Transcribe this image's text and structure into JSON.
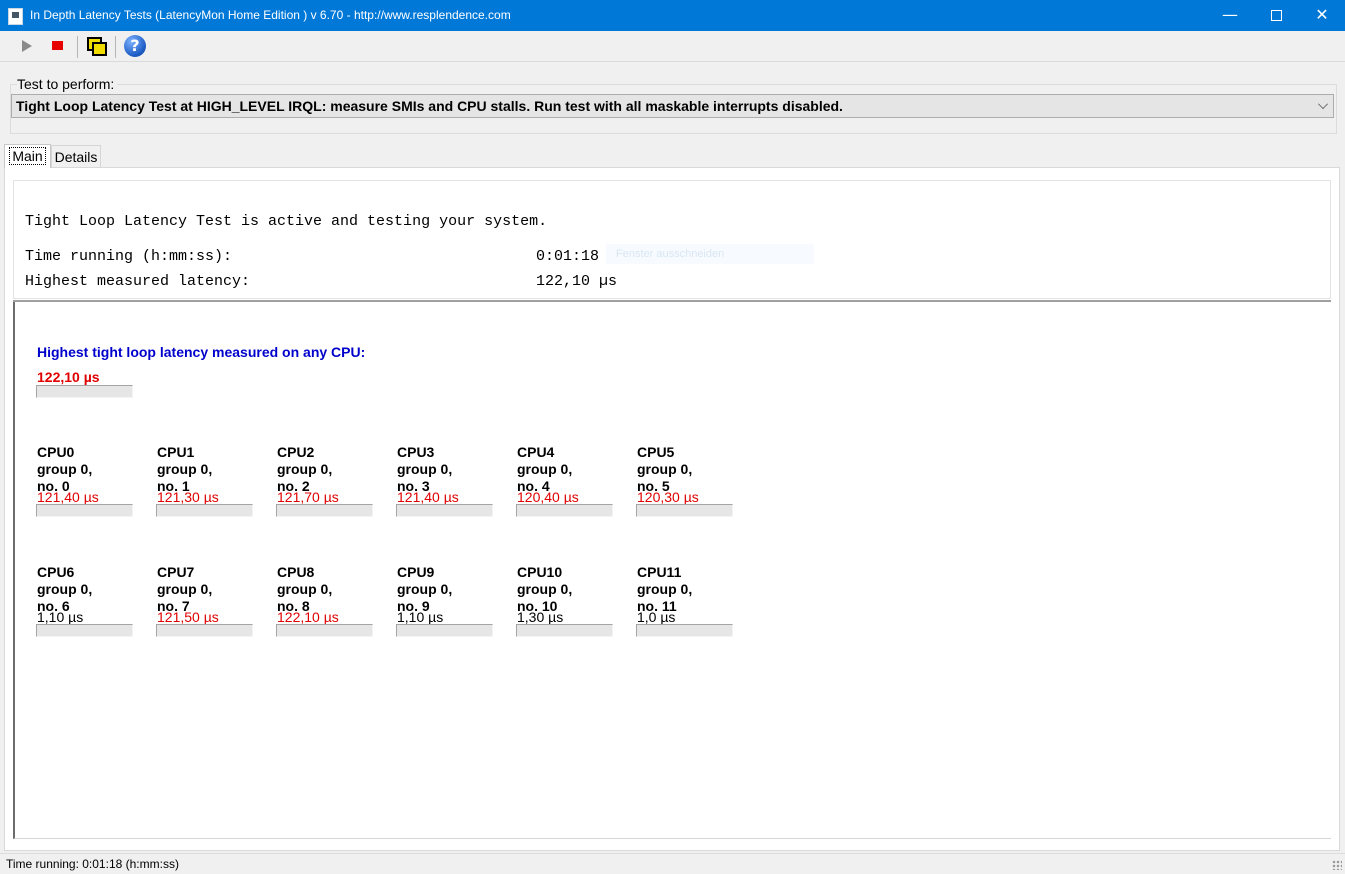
{
  "window": {
    "title": "In Depth Latency Tests  (LatencyMon Home Edition )  v 6.70 - http://www.resplendence.com",
    "min_glyph": "—",
    "close_glyph": "✕"
  },
  "toolbar": {
    "help_glyph": "?"
  },
  "test_group": {
    "label": "Test to perform:",
    "selected": "Tight Loop Latency Test at HIGH_LEVEL IRQL:  measure SMIs and CPU stalls. Run test with all maskable interrupts disabled."
  },
  "tabs": [
    {
      "label": "Main"
    },
    {
      "label": "Details"
    }
  ],
  "summary": {
    "active_text": "Tight Loop Latency Test is active and testing your system.",
    "time_label": "Time running (h:mm:ss):",
    "time_value": "0:01:18",
    "latency_label": "Highest measured latency:",
    "latency_value": "122,10 µs",
    "ghost_text": "Fenster ausschneiden"
  },
  "highest": {
    "heading": "Highest tight loop latency measured on any CPU:",
    "value": "122,10 µs",
    "fill": 0.0
  },
  "cpus": [
    {
      "name": "CPU0",
      "group": "group 0,",
      "no": "no. 0",
      "value": "121,40 µs",
      "status": "red"
    },
    {
      "name": "CPU1",
      "group": "group 0,",
      "no": "no. 1",
      "value": "121,30 µs",
      "status": "red"
    },
    {
      "name": "CPU2",
      "group": "group 0,",
      "no": "no. 2",
      "value": "121,70 µs",
      "status": "red"
    },
    {
      "name": "CPU3",
      "group": "group 0,",
      "no": "no. 3",
      "value": "121,40 µs",
      "status": "red"
    },
    {
      "name": "CPU4",
      "group": "group 0,",
      "no": "no. 4",
      "value": "120,40 µs",
      "status": "red"
    },
    {
      "name": "CPU5",
      "group": "group 0,",
      "no": "no. 5",
      "value": "120,30 µs",
      "status": "red"
    },
    {
      "name": "CPU6",
      "group": "group 0,",
      "no": "no. 6",
      "value": "1,10 µs",
      "status": "black"
    },
    {
      "name": "CPU7",
      "group": "group 0,",
      "no": "no. 7",
      "value": "121,50 µs",
      "status": "red"
    },
    {
      "name": "CPU8",
      "group": "group 0,",
      "no": "no. 8",
      "value": "122,10 µs",
      "status": "red"
    },
    {
      "name": "CPU9",
      "group": "group 0,",
      "no": "no. 9",
      "value": "1,10 µs",
      "status": "black"
    },
    {
      "name": "CPU10",
      "group": "group 0,",
      "no": "no. 10",
      "value": "1,30 µs",
      "status": "black"
    },
    {
      "name": "CPU11",
      "group": "group 0,",
      "no": "no. 11",
      "value": "1,0 µs",
      "status": "black"
    }
  ],
  "statusbar": {
    "text": "Time running: 0:01:18  (h:mm:ss)"
  }
}
